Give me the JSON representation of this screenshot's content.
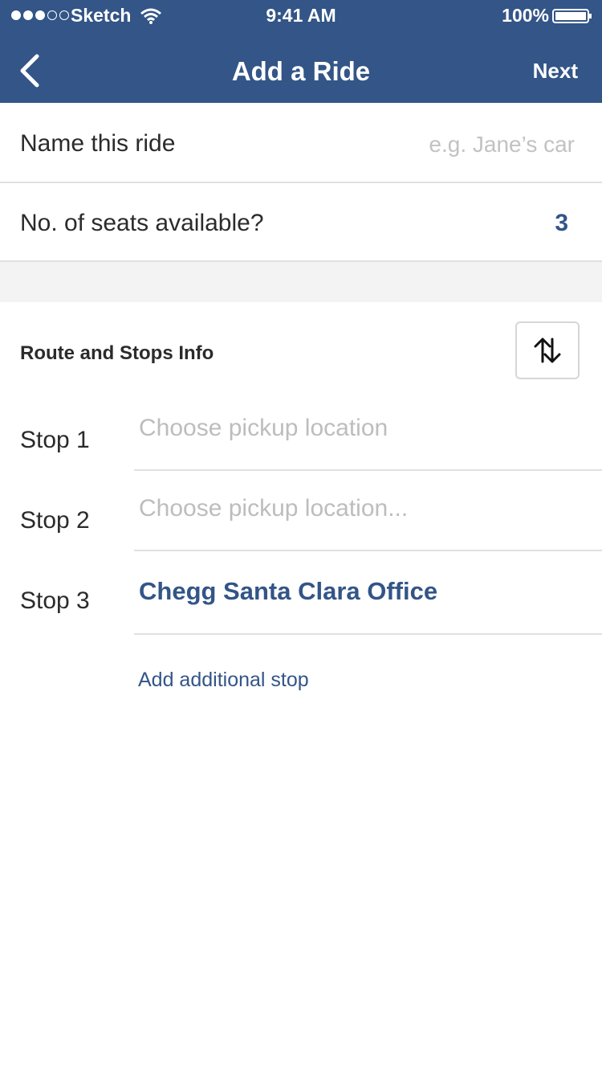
{
  "status_bar": {
    "carrier": "Sketch",
    "time": "9:41 AM",
    "battery": "100%",
    "signal_icon": "signal-dots-icon",
    "wifi_icon": "wifi-icon",
    "battery_icon": "battery-icon"
  },
  "nav": {
    "back_icon": "chevron-left-icon",
    "title": "Add a Ride",
    "next_label": "Next"
  },
  "form": {
    "name_label": "Name this ride",
    "name_value": "",
    "name_placeholder": "e.g. Jane’s car",
    "seats_label": "No. of seats available?",
    "seats_value": "3"
  },
  "route": {
    "heading": "Route and Stops Info",
    "swap_icon": "swap-vertical-arrows-icon",
    "stops": [
      {
        "label": "Stop 1",
        "value": "",
        "placeholder": "Choose pickup location"
      },
      {
        "label": "Stop 2",
        "value": "",
        "placeholder": "Choose pickup location..."
      },
      {
        "label": "Stop 3",
        "value": "Chegg Santa Clara Office",
        "placeholder": ""
      }
    ],
    "add_stop_label": "Add additional stop"
  },
  "colors": {
    "brand": "#335587",
    "placeholder": "#c2c2c2",
    "divider": "#e0e0e0",
    "section_bg": "#f3f3f3"
  }
}
